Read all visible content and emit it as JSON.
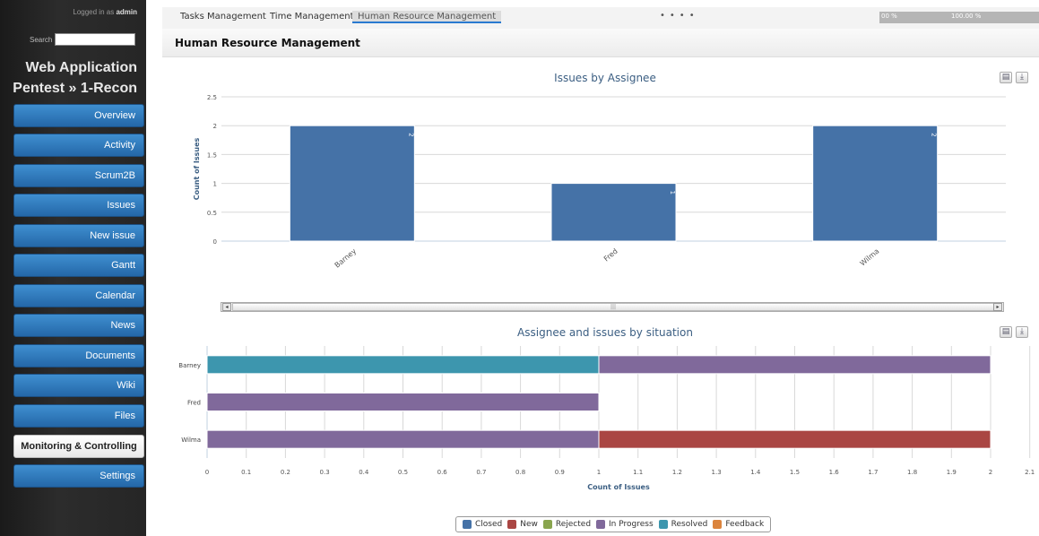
{
  "sidebar": {
    "logged_in_prefix": "Logged in as",
    "logged_in_user": "admin",
    "search_label": "Search",
    "project_title_line1": "Web Application",
    "project_title_line2": "Pentest » 1-Recon",
    "items": [
      {
        "label": "Overview"
      },
      {
        "label": "Activity"
      },
      {
        "label": "Scrum2B"
      },
      {
        "label": "Issues"
      },
      {
        "label": "New issue"
      },
      {
        "label": "Gantt"
      },
      {
        "label": "Calendar"
      },
      {
        "label": "News"
      },
      {
        "label": "Documents"
      },
      {
        "label": "Wiki"
      },
      {
        "label": "Files"
      },
      {
        "label": "Monitoring & Controlling"
      },
      {
        "label": "Settings"
      }
    ],
    "active_item": "Monitoring & Controlling"
  },
  "tabs": [
    {
      "label": "Tasks Management"
    },
    {
      "label": "Time Management"
    },
    {
      "label": "Human Resource Management"
    }
  ],
  "active_tab": "Human Resource Management",
  "progress": {
    "left_label": "00 %",
    "right_label": "100.00 %"
  },
  "panel": {
    "title": "Human Resource Management"
  },
  "icons": {
    "print": "print-icon",
    "export": "download-icon"
  },
  "colors": {
    "accent": "#4572a7",
    "nav_blue": "#2f7fc4"
  },
  "chart_data": [
    {
      "type": "bar",
      "title": "Issues by Assignee",
      "xlabel": "",
      "ylabel": "Count of Issues",
      "categories": [
        "Barney",
        "Fred",
        "Wilma"
      ],
      "values": [
        2,
        1,
        2
      ],
      "data_labels": [
        "2",
        "1",
        "2"
      ],
      "yticks": [
        "0",
        "0.5",
        "1",
        "1.5",
        "2",
        "2.5"
      ],
      "ylim": [
        0,
        2.5
      ],
      "color": "#4572a7",
      "grid": true
    },
    {
      "type": "bar",
      "orientation": "horizontal",
      "stacked": true,
      "title": "Assignee and issues by situation",
      "xlabel": "Count of Issues",
      "ylabel": "",
      "categories": [
        "Barney",
        "Fred",
        "Wilma"
      ],
      "xticks": [
        "0",
        "0.1",
        "0.2",
        "0.3",
        "0.4",
        "0.5",
        "0.6",
        "0.7",
        "0.8",
        "0.9",
        "1",
        "1.1",
        "1.2",
        "1.3",
        "1.4",
        "1.5",
        "1.6",
        "1.7",
        "1.8",
        "1.9",
        "2",
        "2.1"
      ],
      "xlim": [
        0,
        2
      ],
      "series": [
        {
          "name": "Closed",
          "color": "#4572a7",
          "values": [
            0,
            0,
            0
          ]
        },
        {
          "name": "New",
          "color": "#aa4643",
          "values": [
            0,
            0,
            1
          ]
        },
        {
          "name": "Rejected",
          "color": "#89a54e",
          "values": [
            0,
            0,
            0
          ]
        },
        {
          "name": "In Progress",
          "color": "#80699b",
          "values": [
            1,
            1,
            1
          ]
        },
        {
          "name": "Resolved",
          "color": "#3d96ae",
          "values": [
            1,
            0,
            0
          ]
        },
        {
          "name": "Feedback",
          "color": "#db843d",
          "values": [
            0,
            0,
            0
          ]
        }
      ],
      "legend_position": "bottom-center",
      "grid": true
    }
  ]
}
